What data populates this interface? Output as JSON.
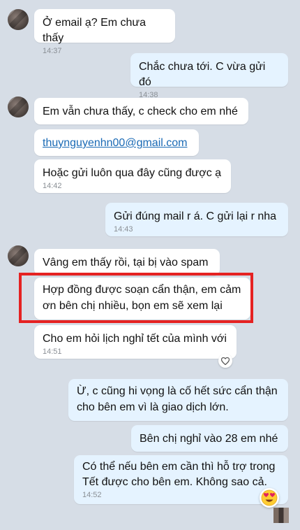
{
  "messages": [
    {
      "id": "m1",
      "text": "Ở email ạ? Em chưa thấy",
      "time": "14:37"
    },
    {
      "id": "m2",
      "text": "Chắc chưa tới. C vừa gửi đó",
      "time": "14:38"
    },
    {
      "id": "m3",
      "text": "Em vẫn chưa thấy, c check cho em nhé"
    },
    {
      "id": "m4",
      "text": "thuynguyenhn00@gmail.com"
    },
    {
      "id": "m5",
      "text": "Hoặc gửi luôn qua đây cũng được ạ",
      "time": "14:42"
    },
    {
      "id": "m6",
      "text": "Gửi đúng mail r á. C gửi lại r nha",
      "time": "14:43"
    },
    {
      "id": "m7",
      "text": "Vâng em thấy rồi, tại bị vào spam"
    },
    {
      "id": "m8",
      "line1": "Hợp đồng được soạn cẩn thận, em cảm",
      "line2": "ơn bên chị nhiều, bọn em sẽ xem lại"
    },
    {
      "id": "m9",
      "text": "Cho em hỏi lịch nghỉ tết của mình với",
      "time": "14:51"
    },
    {
      "id": "m10",
      "line1": "Ừ, c cũng hi vọng là cố hết sức cẩn thận",
      "line2": "cho bên em vì là giao dịch lớn."
    },
    {
      "id": "m11",
      "text": "Bên chị nghỉ vào 28 em nhé"
    },
    {
      "id": "m12",
      "line1": "Có thể nếu bên em cần thì hỗ trợ trong",
      "line2": "Tết được cho bên em. Không sao cả.",
      "time": "14:52"
    }
  ],
  "reactions": {
    "heart": "heart-icon",
    "emoji": "heart-eyes-emoji"
  },
  "colors": {
    "incoming": "#ffffff",
    "outgoing": "#e5f3ff",
    "highlight": "#e52222",
    "background": "#d6dde6"
  }
}
